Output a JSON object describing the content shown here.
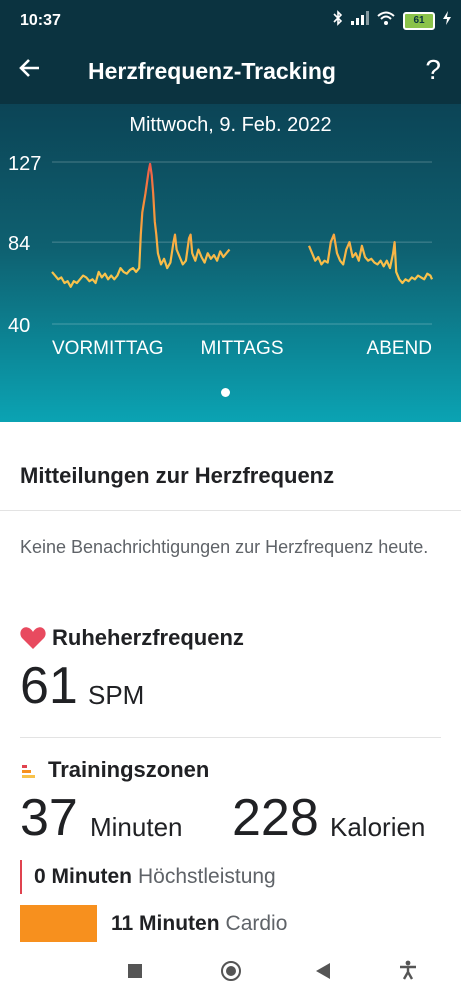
{
  "status": {
    "time": "10:37",
    "battery": "61"
  },
  "appbar": {
    "title": "Herzfrequenz-Tracking",
    "help": "?"
  },
  "hero": {
    "date": "Mittwoch, 9. Feb. 2022",
    "page_dots": 1
  },
  "chart_data": {
    "type": "line",
    "y_ticks": [
      "127",
      "84",
      "40"
    ],
    "x_labels": [
      "VORMITTAG",
      "MITTAGS",
      "ABEND"
    ],
    "ylim": [
      40,
      127
    ],
    "series": [
      {
        "points": [
          [
            0,
            68
          ],
          [
            2,
            66
          ],
          [
            4,
            64
          ],
          [
            6,
            65
          ],
          [
            8,
            62
          ],
          [
            10,
            63
          ],
          [
            12,
            60
          ],
          [
            14,
            63
          ],
          [
            16,
            62
          ],
          [
            18,
            64
          ],
          [
            20,
            66
          ],
          [
            22,
            65
          ],
          [
            24,
            63
          ],
          [
            26,
            64
          ],
          [
            28,
            62
          ],
          [
            30,
            68
          ],
          [
            32,
            65
          ],
          [
            34,
            67
          ],
          [
            36,
            64
          ],
          [
            38,
            66
          ],
          [
            40,
            64
          ],
          [
            42,
            66
          ],
          [
            44,
            70
          ],
          [
            46,
            68
          ],
          [
            48,
            67
          ],
          [
            50,
            69
          ],
          [
            52,
            70
          ],
          [
            54,
            68
          ],
          [
            56,
            70
          ],
          [
            57,
            88
          ],
          [
            58,
            100
          ],
          [
            60,
            110
          ],
          [
            62,
            122
          ],
          [
            63,
            126
          ],
          [
            64,
            120
          ],
          [
            65,
            110
          ],
          [
            66,
            95
          ],
          [
            67,
            88
          ],
          [
            68,
            78
          ],
          [
            70,
            72
          ],
          [
            72,
            75
          ],
          [
            74,
            70
          ],
          [
            76,
            73
          ],
          [
            78,
            84
          ],
          [
            79,
            88
          ],
          [
            80,
            80
          ],
          [
            82,
            76
          ],
          [
            84,
            72
          ],
          [
            86,
            74
          ],
          [
            88,
            86
          ],
          [
            89,
            88
          ],
          [
            90,
            78
          ],
          [
            92,
            74
          ],
          [
            94,
            80
          ],
          [
            96,
            76
          ],
          [
            98,
            73
          ],
          [
            100,
            78
          ],
          [
            102,
            75
          ],
          [
            104,
            77
          ],
          [
            106,
            74
          ],
          [
            108,
            79
          ],
          [
            110,
            76
          ],
          [
            112,
            78
          ],
          [
            114,
            80
          ]
        ]
      },
      {
        "points": [
          [
            165,
            82
          ],
          [
            167,
            78
          ],
          [
            169,
            74
          ],
          [
            171,
            76
          ],
          [
            173,
            72
          ],
          [
            175,
            74
          ],
          [
            177,
            73
          ],
          [
            179,
            84
          ],
          [
            181,
            88
          ],
          [
            183,
            78
          ],
          [
            185,
            74
          ],
          [
            187,
            72
          ],
          [
            189,
            80
          ],
          [
            191,
            84
          ],
          [
            193,
            76
          ],
          [
            195,
            78
          ],
          [
            197,
            74
          ],
          [
            199,
            82
          ],
          [
            201,
            76
          ],
          [
            203,
            74
          ],
          [
            205,
            75
          ],
          [
            207,
            73
          ],
          [
            209,
            72
          ],
          [
            211,
            74
          ],
          [
            213,
            71
          ],
          [
            215,
            74
          ],
          [
            217,
            70
          ],
          [
            219,
            78
          ],
          [
            220,
            84
          ],
          [
            221,
            68
          ],
          [
            223,
            64
          ],
          [
            225,
            62
          ],
          [
            227,
            64
          ],
          [
            229,
            63
          ],
          [
            231,
            65
          ],
          [
            233,
            64
          ],
          [
            235,
            66
          ],
          [
            237,
            65
          ],
          [
            239,
            64
          ],
          [
            241,
            67
          ],
          [
            243,
            66
          ],
          [
            244,
            64
          ]
        ]
      }
    ]
  },
  "notifications": {
    "title": "Mitteilungen zur Herzfrequenz",
    "text": "Keine Benachrichtigungen zur Herzfrequenz heute."
  },
  "resting": {
    "title": "Ruheherzfrequenz",
    "value": "61",
    "unit": "SPM",
    "heart_color": "#e84a5f"
  },
  "training": {
    "title": "Trainingszonen",
    "minutes": "37",
    "minutes_unit": "Minuten",
    "calories": "228",
    "calories_unit": "Kalorien",
    "zones": [
      {
        "amount": "0 Minuten",
        "name": "Höchstleistung",
        "color": "#e0434f"
      },
      {
        "amount": "11 Minuten",
        "name": "Cardio",
        "color": "#f7901e"
      }
    ]
  }
}
